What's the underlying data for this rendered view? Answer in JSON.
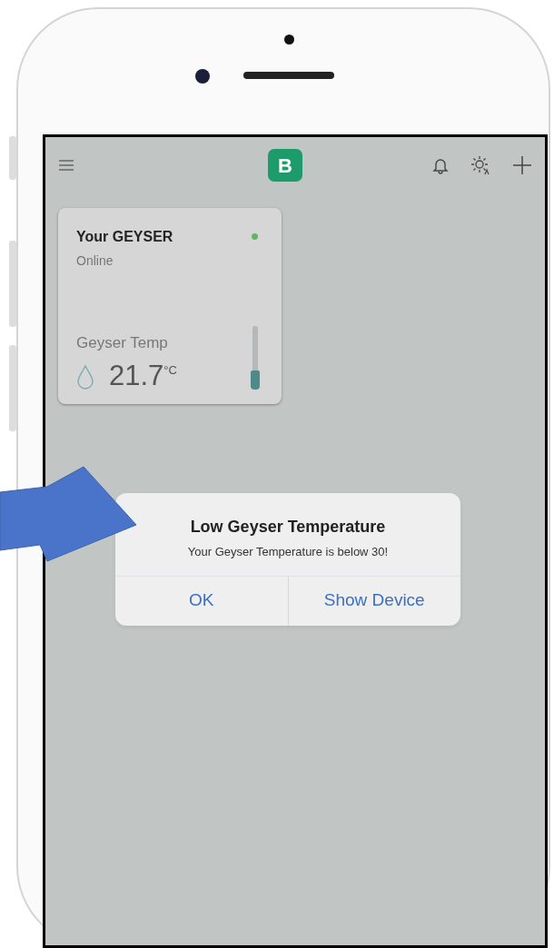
{
  "app_bar": {
    "logo": "B"
  },
  "device_card": {
    "title": "Your GEYSER",
    "status": "Online",
    "color": "#5cb85c",
    "sensor_label": "Geyser Temp",
    "value": "21.7",
    "unit": "°C",
    "level": 0.3
  },
  "alert": {
    "title": "Low Geyser Temperature",
    "message": "Your Geyser Temperature is below 30!",
    "buttons": [
      "OK",
      "Show Device"
    ]
  }
}
